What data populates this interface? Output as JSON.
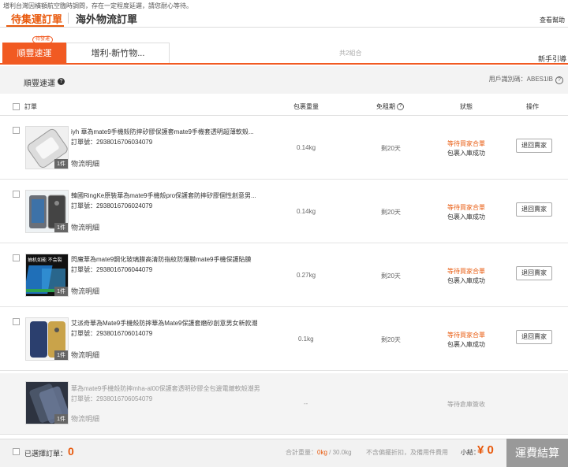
{
  "notice": "增利台灣因橫額航空臨時調問，存在一定程度延遲，請您耐心等待。",
  "tabs": {
    "active": "待集運訂單",
    "other": "海外物流訂單"
  },
  "help_link": "查看幫助",
  "subtabs": {
    "badge": "待發運",
    "active": "順豐速運",
    "other": "增利-新竹物..."
  },
  "total_groups": "共2組合",
  "guide": "新手引導",
  "group": {
    "name": "順豐速運",
    "help_icon": "?",
    "user_id_label": "用戶識別碼：",
    "user_id": "ABES1IB"
  },
  "columns": {
    "order": "訂單",
    "weight": "包裹重量",
    "free_period": "免租期",
    "status": "狀態",
    "action": "操作"
  },
  "rows": [
    {
      "title": "iyh 華為mate9手機殼防摔矽膠保護套mate9手機套透明超薄軟殼...",
      "order_label": "訂單號：",
      "order_no": "2938016706034079",
      "qty": "1件",
      "logistics": "物流明細",
      "weight": "0.14kg",
      "period": "剩20天",
      "status1": "等待買家合單",
      "status2": "包裹入庫成功",
      "action": "退回賣家",
      "thumb": "case"
    },
    {
      "title": "韓國RingKe原裝華為mate9手機殼pro保護套防摔矽膠個性創意男...",
      "order_label": "訂單號：",
      "order_no": "2938016706024079",
      "qty": "1件",
      "logistics": "物流明細",
      "weight": "0.14kg",
      "period": "剩20天",
      "status1": "等待買家合單",
      "status2": "包裹入庫成功",
      "action": "退回賣家",
      "thumb": "phone"
    },
    {
      "title": "閃魔華為mate9鋼化玻璃膜高清防指紋防爆膜mate9手機保護貼膜",
      "order_label": "訂單號：",
      "order_no": "2938016706044079",
      "qty": "1件",
      "logistics": "物流明細",
      "weight": "0.27kg",
      "period": "剩20天",
      "status1": "等待買家合單",
      "status2": "包裹入庫成功",
      "action": "退回賣家",
      "thumb": "glass",
      "thumb_text": "抽机如能 不会裂"
    },
    {
      "title": "艾派奇華為Mate9手機殼防摔華為Mate9保護套磨砂創意男女新款潮",
      "order_label": "訂單號：",
      "order_no": "2938016706014079",
      "qty": "1件",
      "logistics": "物流明細",
      "weight": "0.1kg",
      "period": "剩20天",
      "status1": "等待買家合單",
      "status2": "包裹入庫成功",
      "action": "退回賣家",
      "thumb": "gold"
    },
    {
      "title": "華為mate9手機殼防摔mha-al00保護套透明矽膠全包邊電鍍軟殼潮男",
      "order_label": "訂單號：",
      "order_no": "2938016706054079",
      "qty": "1件",
      "logistics": "物流明細",
      "weight": "--",
      "period": "",
      "status1": "等待倉庫簽收",
      "status2": "",
      "action": "",
      "thumb": "dark"
    }
  ],
  "footer": {
    "selected_label": "已選擇訂單：",
    "selected_count": "0",
    "weight_label": "合計重量：",
    "weight_value": "0kg",
    "weight_sep": " / ",
    "weight_max": "30.0kg",
    "note": "不含偏擺折扣，及備用件費用",
    "subtotal_label": "小結：",
    "subtotal_value": "¥ 0",
    "checkout": "運費結算"
  },
  "colors": {
    "accent": "#f15a22",
    "status_orange": "#e8590c",
    "disabled": "#999999"
  }
}
